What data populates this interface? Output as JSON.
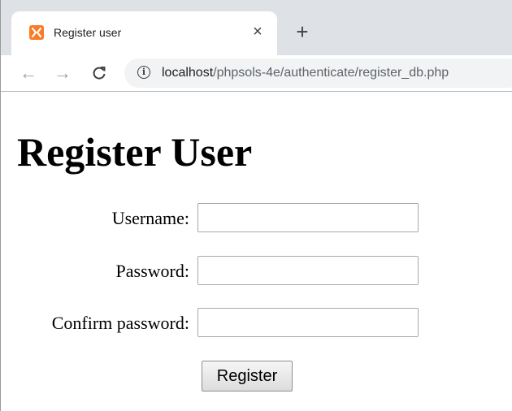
{
  "browser": {
    "tab": {
      "title": "Register user",
      "favicon": "xampp-icon",
      "close_glyph": "×"
    },
    "new_tab_glyph": "+",
    "nav": {
      "back_glyph": "←",
      "forward_glyph": "→",
      "reload_glyph": "C"
    },
    "address": {
      "info_glyph": "i",
      "host": "localhost",
      "path": "/phpsols-4e/authenticate/register_db.php"
    }
  },
  "page": {
    "heading": "Register User",
    "form": {
      "username_label": "Username:",
      "username_value": "",
      "password_label": "Password:",
      "password_value": "",
      "confirm_label": "Confirm password:",
      "confirm_value": "",
      "submit_label": "Register"
    }
  },
  "colors": {
    "favicon": "#fb7a24",
    "tabstrip": "#dee1e6",
    "omnibox": "#f1f3f4"
  }
}
